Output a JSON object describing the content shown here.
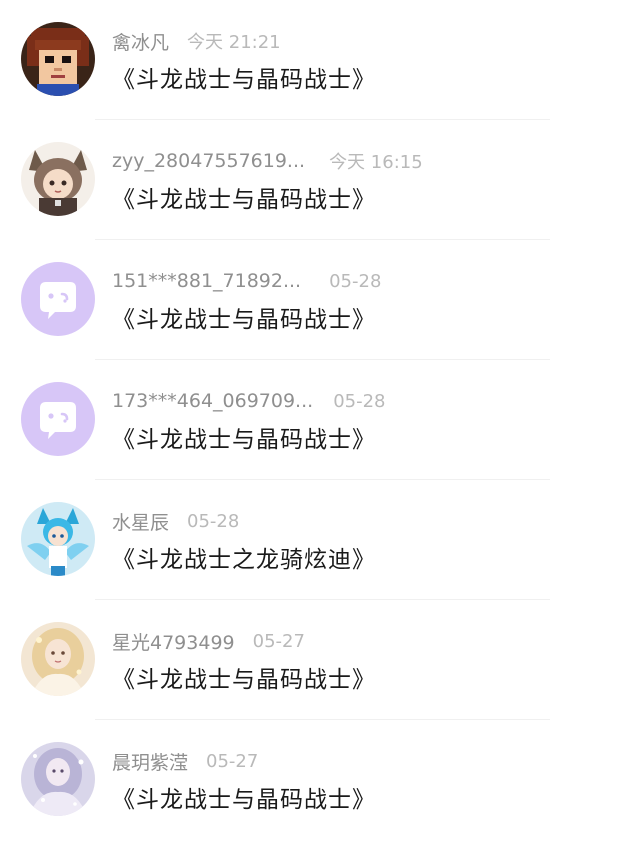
{
  "comments": [
    {
      "name": "禽冰凡",
      "time": "今天 21:21",
      "title": "《斗龙战士与晶码战士》",
      "avatar_icon": "pixel-boy-avatar"
    },
    {
      "name": "zyy_28047557619...",
      "time": "今天 16:15",
      "title": "《斗龙战士与晶码战士》",
      "avatar_icon": "catgirl-avatar"
    },
    {
      "name": "151***881_71892...",
      "time": "05-28",
      "title": "《斗龙战士与晶码战士》",
      "avatar_icon": "default-chat-avatar"
    },
    {
      "name": "173***464_069709...",
      "time": "05-28",
      "title": "《斗龙战士与晶码战士》",
      "avatar_icon": "default-chat-avatar"
    },
    {
      "name": "水星辰",
      "time": "05-28",
      "title": "《斗龙战士之龙骑炫迪》",
      "avatar_icon": "blue-anime-avatar"
    },
    {
      "name": "星光4793499",
      "time": "05-27",
      "title": "《斗龙战士与晶码战士》",
      "avatar_icon": "golden-angel-avatar"
    },
    {
      "name": "晨玥紫滢",
      "time": "05-27",
      "title": "《斗龙战士与晶码战士》",
      "avatar_icon": "silver-angel-avatar"
    }
  ],
  "colors": {
    "default_avatar_bg": "#d7c6f7",
    "name": "#8f8f8f",
    "time": "#b9b9b9",
    "title": "#1a1a1a"
  }
}
